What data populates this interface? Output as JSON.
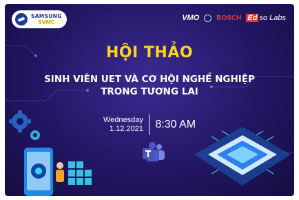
{
  "sponsors": {
    "samsung_line1": "SAMSUNG",
    "samsung_line2": "SVMC",
    "vmo": "VMO",
    "bosch": "BOSCH",
    "edso_prefix": "Ed",
    "edso_suffix": "so Labs"
  },
  "event": {
    "title": "HỘI THẢO",
    "subtitle_line1": "SINH VIÊN UET VÀ CƠ HỘI NGHỀ NGHIỆP",
    "subtitle_line2": "TRONG TƯƠNG LAI",
    "day": "Wednesday",
    "date": "1.12.2021",
    "time": "8:30 AM"
  },
  "colors": {
    "background": "#231663",
    "title": "#ffd21f",
    "accent_cyan": "#36d6f5",
    "accent_red": "#e53935"
  },
  "icons": [
    "samsung-logo-icon",
    "bosch-logo-icon",
    "teams-icon",
    "gear-icon",
    "chip-icon",
    "person-illustration"
  ]
}
